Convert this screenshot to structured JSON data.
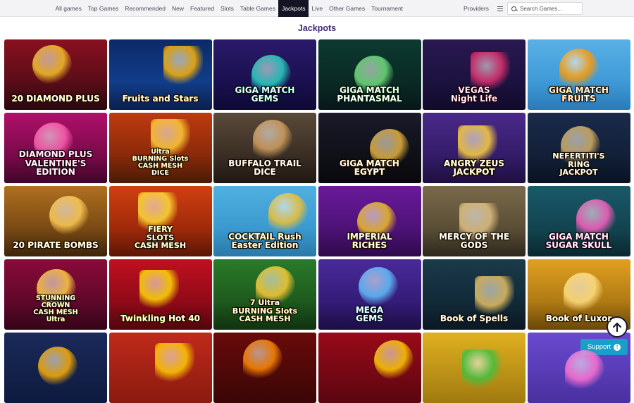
{
  "nav": {
    "items": [
      "All games",
      "Top Games",
      "Recommended",
      "New",
      "Featured",
      "Slots",
      "Table Games",
      "Jackpots",
      "Live",
      "Other Games",
      "Tournament"
    ],
    "active": "Jackpots",
    "providers_label": "Providers"
  },
  "search": {
    "placeholder": "Search Games..."
  },
  "section": {
    "title": "Jackpots"
  },
  "games": [
    {
      "title": "20 DIAMOND PLUS",
      "bg": "linear-gradient(180deg,#8a1020,#5a0d18 60%,#2a0810)",
      "accent": "#f7c325"
    },
    {
      "title": "Fruits and Stars",
      "bg": "linear-gradient(180deg,#0b2a66,#123d8a 60%,#0b1f4a)",
      "accent": "#ffb400"
    },
    {
      "title": "GIGA MATCH\nGEMS",
      "bg": "linear-gradient(180deg,#2a1a6a,#1a1050 60%,#0f0a35)",
      "accent": "#27d3c3"
    },
    {
      "title": "GIGA MATCH\nPHANTASMAL",
      "bg": "linear-gradient(180deg,#0c3a30,#0a2a24 60%,#07171a)",
      "accent": "#6ee07a"
    },
    {
      "title": "VEGAS\nNight Life",
      "bg": "linear-gradient(180deg,#2a1850,#1c1240 60%,#120a2a)",
      "accent": "#e0306e"
    },
    {
      "title": "GIGA MATCH\nFRUITS",
      "bg": "linear-gradient(180deg,#5ab0e6,#3e9ad6 60%,#2a7ab8)",
      "accent": "#ff9a00"
    },
    {
      "title": "DIAMOND PLUS\nVALENTINE'S EDITION",
      "bg": "linear-gradient(180deg,#b0106a,#7a0a4a 60%,#40062a)",
      "accent": "#ff5fb0"
    },
    {
      "title": "Ultra\nBURNING Slots\nCASH MESH\nDICE",
      "bg": "linear-gradient(180deg,#c03a10,#8a2a0a 60%,#4a1a06)",
      "accent": "#ffcc33"
    },
    {
      "title": "BUFFALO TRAIL\nDICE",
      "bg": "linear-gradient(180deg,#5a4a3a,#3a2e24 60%,#201812)",
      "accent": "#d4a060"
    },
    {
      "title": "GIGA MATCH\nEGYPT",
      "bg": "linear-gradient(180deg,#1a1a2a,#101018 60%,#08080c)",
      "accent": "#e8b23a"
    },
    {
      "title": "ANGRY ZEUS\nJACKPOT",
      "bg": "linear-gradient(180deg,#4a2a8a,#341c6a 60%,#1e0f40)",
      "accent": "#ffd23a"
    },
    {
      "title": "NEFERTITI'S\nRING\nJACKPOT",
      "bg": "linear-gradient(180deg,#1a2a4a,#122038 60%,#0a1224)",
      "accent": "#d8b060"
    },
    {
      "title": "20 PIRATE BOMBS",
      "bg": "linear-gradient(180deg,#b07020,#7a4a14 60%,#3e240a)",
      "accent": "#ffcc55"
    },
    {
      "title": "FIERY\nSLOTS\nCASH MESH",
      "bg": "linear-gradient(180deg,#d04010,#a02a0a 60%,#5a1606)",
      "accent": "#ffdd33"
    },
    {
      "title": "COCKTAIL Rush\nEaster Edition",
      "bg": "linear-gradient(180deg,#50b0e0,#3a9ad0 60%,#2a78a8)",
      "accent": "#f0c030"
    },
    {
      "title": "IMPERIAL\nRICHES",
      "bg": "linear-gradient(180deg,#6a1a9a,#4e1278 60%,#2e0a4a)",
      "accent": "#f0c020"
    },
    {
      "title": "MERCY OF THE GODS",
      "bg": "linear-gradient(180deg,#7a6a4a,#5a4e36 60%,#2e281c)",
      "accent": "#e0c080"
    },
    {
      "title": "GIGA MATCH\nSUGAR SKULL",
      "bg": "linear-gradient(180deg,#1a5a6a,#124450 60%,#0a2830)",
      "accent": "#ff5fc0"
    },
    {
      "title": "STUNNING\nCROWN\nCASH MESH\nUltra",
      "bg": "linear-gradient(180deg,#8a0a3a,#60082a 60%,#340418)",
      "accent": "#ffd040"
    },
    {
      "title": "Twinkling Hot 40",
      "bg": "linear-gradient(180deg,#c01020,#900a18 60%,#50060c)",
      "accent": "#ffdd00"
    },
    {
      "title": "7 Ultra\nBURNING Slots\nCASH MESH",
      "bg": "linear-gradient(180deg,#2a7a2a,#1e5a1e 60%,#0f320f)",
      "accent": "#ffcc33"
    },
    {
      "title": "MEGA\nGEMS",
      "bg": "linear-gradient(180deg,#4a2a9a,#341c78 60%,#1c0e44)",
      "accent": "#5fc0ff"
    },
    {
      "title": "Book of Spells",
      "bg": "linear-gradient(180deg,#1a3a4a,#122a38 60%,#0a1822)",
      "accent": "#e8c060"
    },
    {
      "title": "Book of Luxor",
      "bg": "linear-gradient(180deg,#e0a020,#b07a14 60%,#6a4608)",
      "accent": "#ffe080"
    },
    {
      "title": "",
      "bg": "linear-gradient(180deg,#1a2a5a,#0e1a3e)",
      "accent": "#ffb000"
    },
    {
      "title": "",
      "bg": "linear-gradient(180deg,#c02a1a,#8a1a10)",
      "accent": "#ffcc00"
    },
    {
      "title": "",
      "bg": "linear-gradient(180deg,#6a0a0a,#3a0606)",
      "accent": "#ff8a00"
    },
    {
      "title": "",
      "bg": "linear-gradient(180deg,#9a0a1a,#5a0610)",
      "accent": "#ffcc00"
    },
    {
      "title": "",
      "bg": "linear-gradient(180deg,#e0b020,#a07a10)",
      "accent": "#40c040"
    },
    {
      "title": "",
      "bg": "linear-gradient(180deg,#6a4ad0,#4a30a0)",
      "accent": "#ff70d0"
    }
  ],
  "support": {
    "label": "Support"
  }
}
